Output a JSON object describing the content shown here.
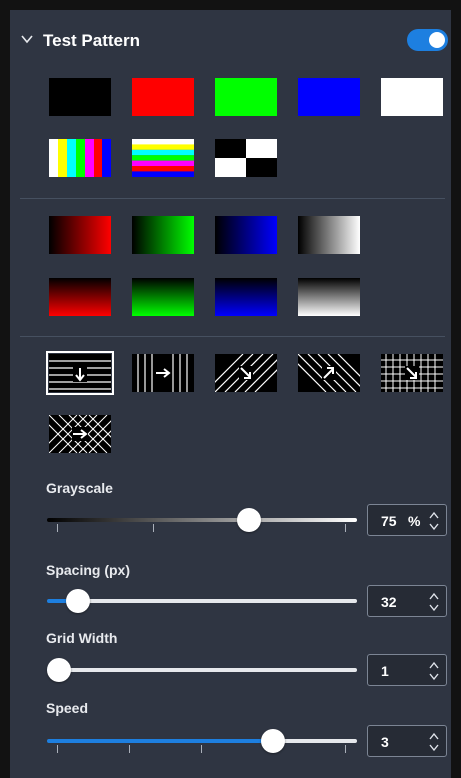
{
  "section": {
    "title": "Test Pattern",
    "enabled": true,
    "accent": "#1d7fe0"
  },
  "solid_swatches": [
    "#000000",
    "#ff0000",
    "#00ff00",
    "#0000ff",
    "#ffffff"
  ],
  "gradient_swatches": {
    "horizontal": [
      "red",
      "green",
      "blue",
      "white"
    ],
    "vertical": [
      "red",
      "green",
      "blue",
      "white"
    ]
  },
  "motion_patterns": [
    "horizontal-lines-down",
    "vertical-lines-right",
    "diagonal-down-right",
    "diagonal-up-right",
    "grid-down-right",
    "crosshatch-right"
  ],
  "selected_motion_pattern": 0,
  "controls": {
    "grayscale": {
      "label": "Grayscale",
      "value": "75",
      "unit": "%",
      "level": 0.65
    },
    "spacing": {
      "label": "Spacing (px)",
      "value": "32",
      "level": 0.1
    },
    "grid_width": {
      "label": "Grid Width",
      "value": "1",
      "level": 0.04
    },
    "speed": {
      "label": "Speed",
      "value": "3",
      "level": 0.73
    }
  }
}
